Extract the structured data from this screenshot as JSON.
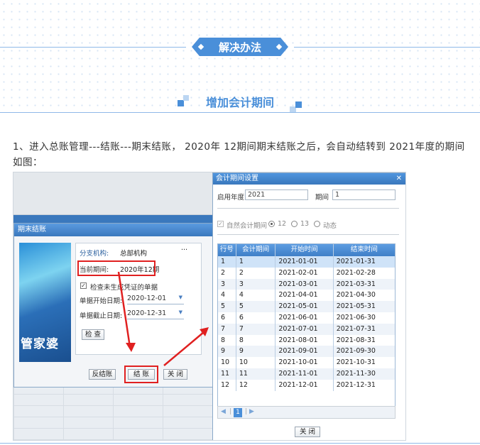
{
  "banner": {
    "title": "解决办法"
  },
  "subheading": "增加会计期间",
  "intro": "1、进入总账管理---结账---期末结账， 2020年 12期间期末结账之后，会自动结转到 2021年度的期间 如图：",
  "dialog1": {
    "title": "期末结账",
    "logo_text": "管家婆",
    "branch_label": "分支机构:",
    "branch_value": "总部机构",
    "more_glyph": "···",
    "current_period_label": "当前期间:",
    "current_period_value": "2020年12期",
    "check_label": "检查未生成凭证的单据",
    "start_date_label": "单据开始日期:",
    "start_date": "2020-12-01",
    "end_date_label": "单据截止日期:",
    "end_date": "2020-12-31",
    "check_button": "检 查",
    "reverse_button": "反结账",
    "close_period_button": "结 账",
    "close_button": "关 闭"
  },
  "dialog2": {
    "title": "会计期间设置",
    "start_year_label": "启用年度",
    "start_year": "2021",
    "period_label": "期间",
    "period": "1",
    "natural_label": "自然会计期间",
    "opt_12": "12",
    "opt_13": "13",
    "opt_dynamic": "动态",
    "columns": [
      "行号",
      "会计期间",
      "开始时间",
      "结束时间"
    ],
    "rows": [
      [
        "1",
        "1",
        "2021-01-01",
        "2021-01-31"
      ],
      [
        "2",
        "2",
        "2021-02-01",
        "2021-02-28"
      ],
      [
        "3",
        "3",
        "2021-03-01",
        "2021-03-31"
      ],
      [
        "4",
        "4",
        "2021-04-01",
        "2021-04-30"
      ],
      [
        "5",
        "5",
        "2021-05-01",
        "2021-05-31"
      ],
      [
        "6",
        "6",
        "2021-06-01",
        "2021-06-30"
      ],
      [
        "7",
        "7",
        "2021-07-01",
        "2021-07-31"
      ],
      [
        "8",
        "8",
        "2021-08-01",
        "2021-08-31"
      ],
      [
        "9",
        "9",
        "2021-09-01",
        "2021-09-30"
      ],
      [
        "10",
        "10",
        "2021-10-01",
        "2021-10-31"
      ],
      [
        "11",
        "11",
        "2021-11-01",
        "2021-11-30"
      ],
      [
        "12",
        "12",
        "2021-12-01",
        "2021-12-31"
      ]
    ],
    "pager_sep": "|",
    "page": "1",
    "close_button": "关 闭"
  }
}
